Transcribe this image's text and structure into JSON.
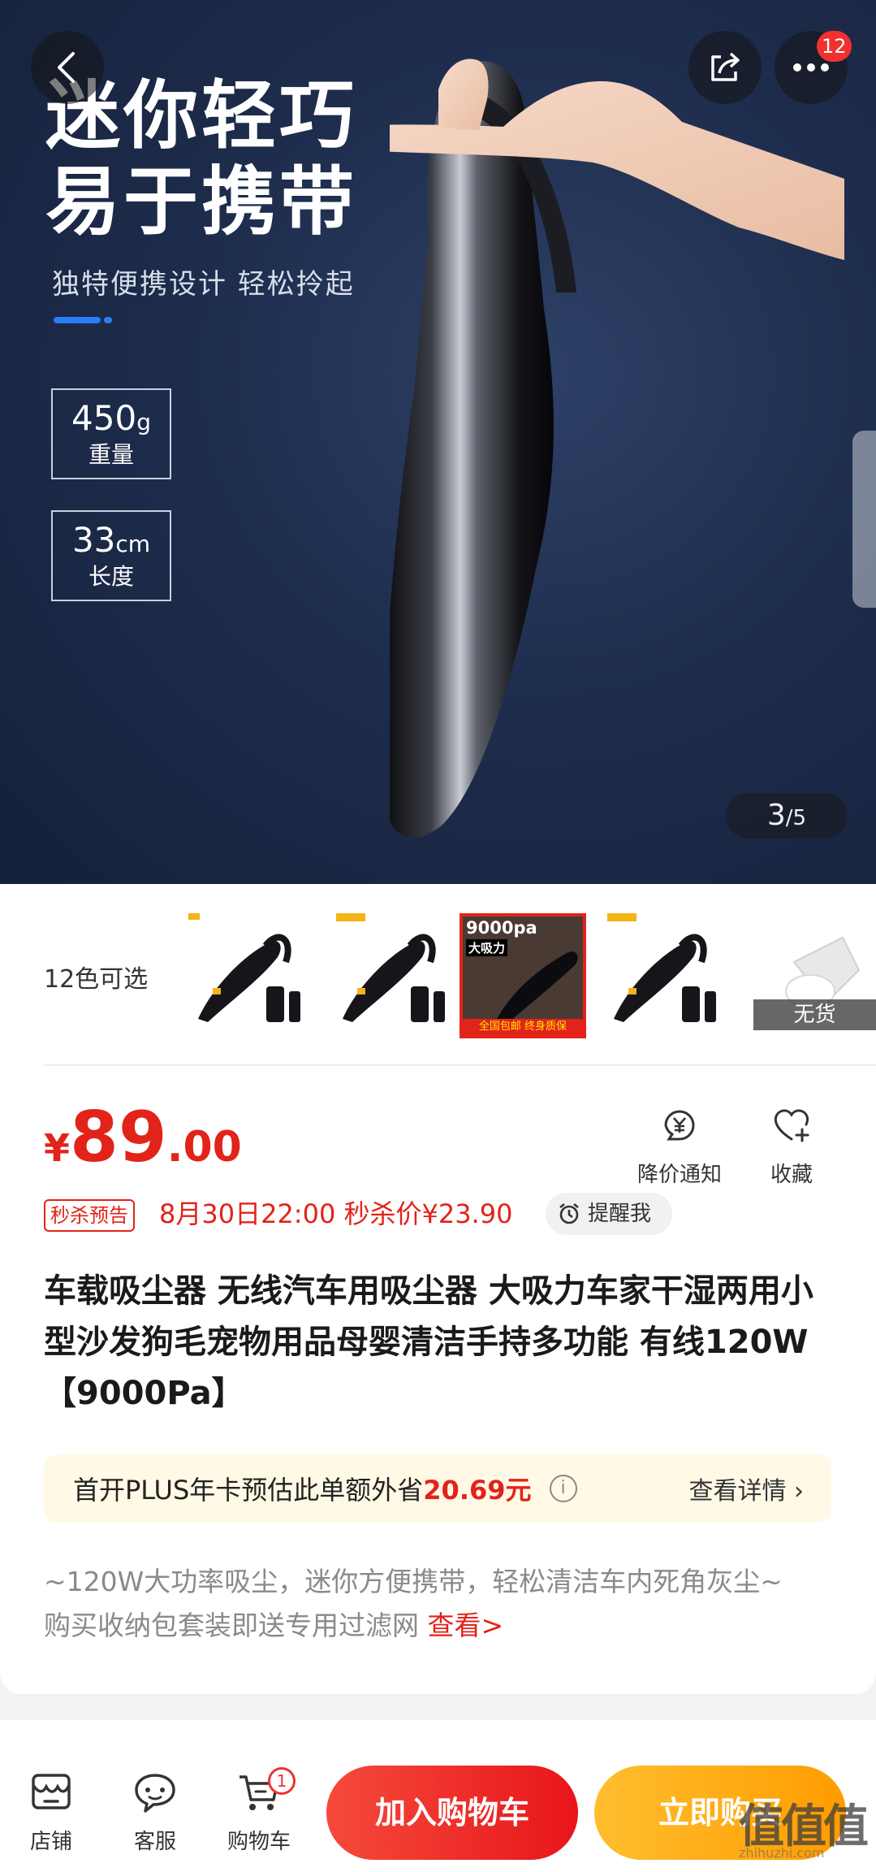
{
  "hero": {
    "title_line1": "迷你轻巧",
    "title_line2": "易于携带",
    "subtitle": "独特便携设计 轻松拎起",
    "specs": [
      {
        "value": "450",
        "unit": "g",
        "label": "重量"
      },
      {
        "value": "33",
        "unit": "cm",
        "label": "长度"
      }
    ],
    "more_badge": "12",
    "image_index": "3",
    "image_total": "/5"
  },
  "variants": {
    "label": "12色可选",
    "selected_line1": "9000pa",
    "selected_line2": "大吸力",
    "selected_footer": "全国包邮 终身质保",
    "unavailable": "无货"
  },
  "price": {
    "currency": "¥",
    "integer": "89",
    "decimal": ".00"
  },
  "actions": {
    "price_alert": "降价通知",
    "favorite": "收藏"
  },
  "seckill": {
    "tag": "秒杀预告",
    "text": "8月30日22:00 秒杀价¥23.90",
    "remind": "提醒我"
  },
  "product": {
    "title": "车载吸尘器 无线汽车用吸尘器 大吸力车家干湿两用小型沙发狗毛宠物用品母婴清洁手持多功能 有线120W【9000Pa】"
  },
  "plus": {
    "text": "首开PLUS年卡预估此单额外省",
    "amount": "20.69元",
    "detail": "查看详情 ›"
  },
  "description": {
    "line1": "~120W大功率吸尘，迷你方便携带，轻松清洁车内死角灰尘~",
    "line2": "购买收纳包套装即送专用过滤网 ",
    "more": "查看>"
  },
  "bottom_bar": {
    "shop": "店铺",
    "service": "客服",
    "cart": "购物车",
    "cart_count": "1",
    "add_to_cart": "加入购物车",
    "buy_now": "立即购买"
  },
  "watermark": {
    "mark": "值值值",
    "site": "zhihuzhi.com"
  },
  "colors": {
    "accent_red": "#e2231a",
    "buy_orange": "#ff9c00",
    "hero_bg": "#1e2d4d"
  }
}
